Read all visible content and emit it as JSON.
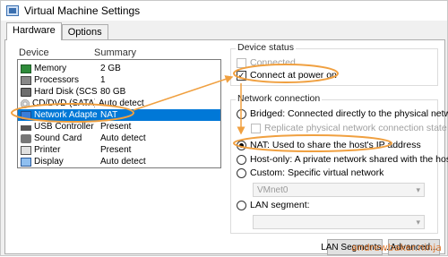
{
  "window": {
    "title": "Virtual Machine Settings"
  },
  "tabs": [
    {
      "label": "Hardware",
      "active": true
    },
    {
      "label": "Options",
      "active": false
    }
  ],
  "devices": {
    "col_device": "Device",
    "col_summary": "Summary",
    "rows": [
      {
        "name": "Memory",
        "summary": "2 GB",
        "icon": "memory-icon"
      },
      {
        "name": "Processors",
        "summary": "1",
        "icon": "processor-icon"
      },
      {
        "name": "Hard Disk (SCSI)",
        "summary": "80 GB",
        "icon": "hard-disk-icon"
      },
      {
        "name": "CD/DVD (SATA)",
        "summary": "Auto detect",
        "icon": "cd-dvd-icon"
      },
      {
        "name": "Network Adapter",
        "summary": "NAT",
        "icon": "network-adapter-icon",
        "selected": true
      },
      {
        "name": "USB Controller",
        "summary": "Present",
        "icon": "usb-icon"
      },
      {
        "name": "Sound Card",
        "summary": "Auto detect",
        "icon": "sound-card-icon"
      },
      {
        "name": "Printer",
        "summary": "Present",
        "icon": "printer-icon"
      },
      {
        "name": "Display",
        "summary": "Auto detect",
        "icon": "display-icon"
      }
    ]
  },
  "device_status": {
    "label": "Device status",
    "connected": {
      "label": "Connected",
      "checked": false,
      "enabled": false
    },
    "connect_at_power_on": {
      "label": "Connect at power on",
      "checked": true
    }
  },
  "network_connection": {
    "label": "Network connection",
    "bridged": "Bridged: Connected directly to the physical network",
    "replicate": "Replicate physical network connection state",
    "nat": "NAT: Used to share the host's IP address",
    "host_only": "Host-only: A private network shared with the host",
    "custom": "Custom: Specific virtual network",
    "vmnet_value": "VMnet0",
    "lan_segment": "LAN segment:",
    "selected": "nat"
  },
  "buttons": {
    "lan_segments": "LAN Segments...",
    "advanced": "Advanced..."
  },
  "watermark": "andrewbaker.ninja",
  "colors": {
    "selection": "#0078d7",
    "annotation": "#f0a040"
  }
}
